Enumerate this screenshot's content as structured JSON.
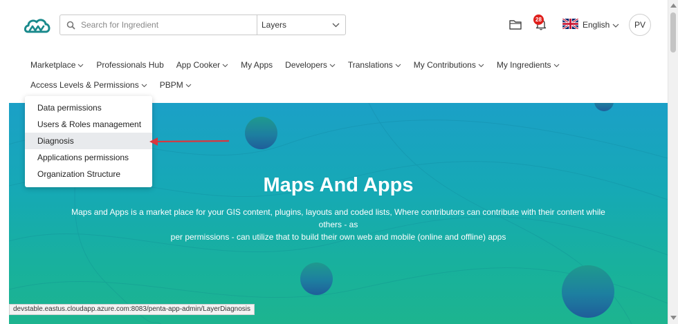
{
  "header": {
    "search": {
      "placeholder": "Search for Ingredient",
      "value": ""
    },
    "layer_select": {
      "value": "Layers"
    },
    "notifications": {
      "count": "28"
    },
    "language": {
      "label": "English"
    },
    "user": {
      "initials": "PV"
    },
    "icons": {
      "logo": "cloud-logo-icon",
      "search": "search-icon",
      "folder": "folder-icon",
      "bell": "bell-icon",
      "flag": "uk-flag-icon"
    }
  },
  "nav": {
    "row1": [
      {
        "label": "Marketplace",
        "dropdown": true
      },
      {
        "label": "Professionals Hub",
        "dropdown": false
      },
      {
        "label": "App Cooker",
        "dropdown": true
      },
      {
        "label": "My Apps",
        "dropdown": false
      },
      {
        "label": "Developers",
        "dropdown": true
      },
      {
        "label": "Translations",
        "dropdown": true
      },
      {
        "label": "My Contributions",
        "dropdown": true
      },
      {
        "label": "My Ingredients",
        "dropdown": true
      }
    ],
    "row2": [
      {
        "label": "Access Levels & Permissions",
        "dropdown": true
      },
      {
        "label": "PBPM",
        "dropdown": true
      }
    ]
  },
  "dropdown_menu": {
    "items": [
      {
        "label": "Data permissions",
        "highlighted": false
      },
      {
        "label": "Users & Roles management",
        "highlighted": false
      },
      {
        "label": "Diagnosis",
        "highlighted": true
      },
      {
        "label": "Applications permissions",
        "highlighted": false
      },
      {
        "label": "Organization Structure",
        "highlighted": false
      }
    ]
  },
  "banner": {
    "title": "Maps And Apps",
    "description_line1": "Maps and Apps is a market place for your GIS content, plugins, layouts and coded lists, Where contributors can contribute with their content while others - as",
    "description_line2": "per permissions - can utilize that to build their own web and mobile (online and offline) apps"
  },
  "status_bar": {
    "url": "devstable.eastus.cloudapp.azure.com:8083/penta-app-admin/LayerDiagnosis"
  },
  "colors": {
    "accent": "#1a8a8c",
    "badge": "#e0201c",
    "banner_top": "#1ba0c7",
    "banner_bottom": "#1db48f",
    "arrow": "#d9363e"
  }
}
